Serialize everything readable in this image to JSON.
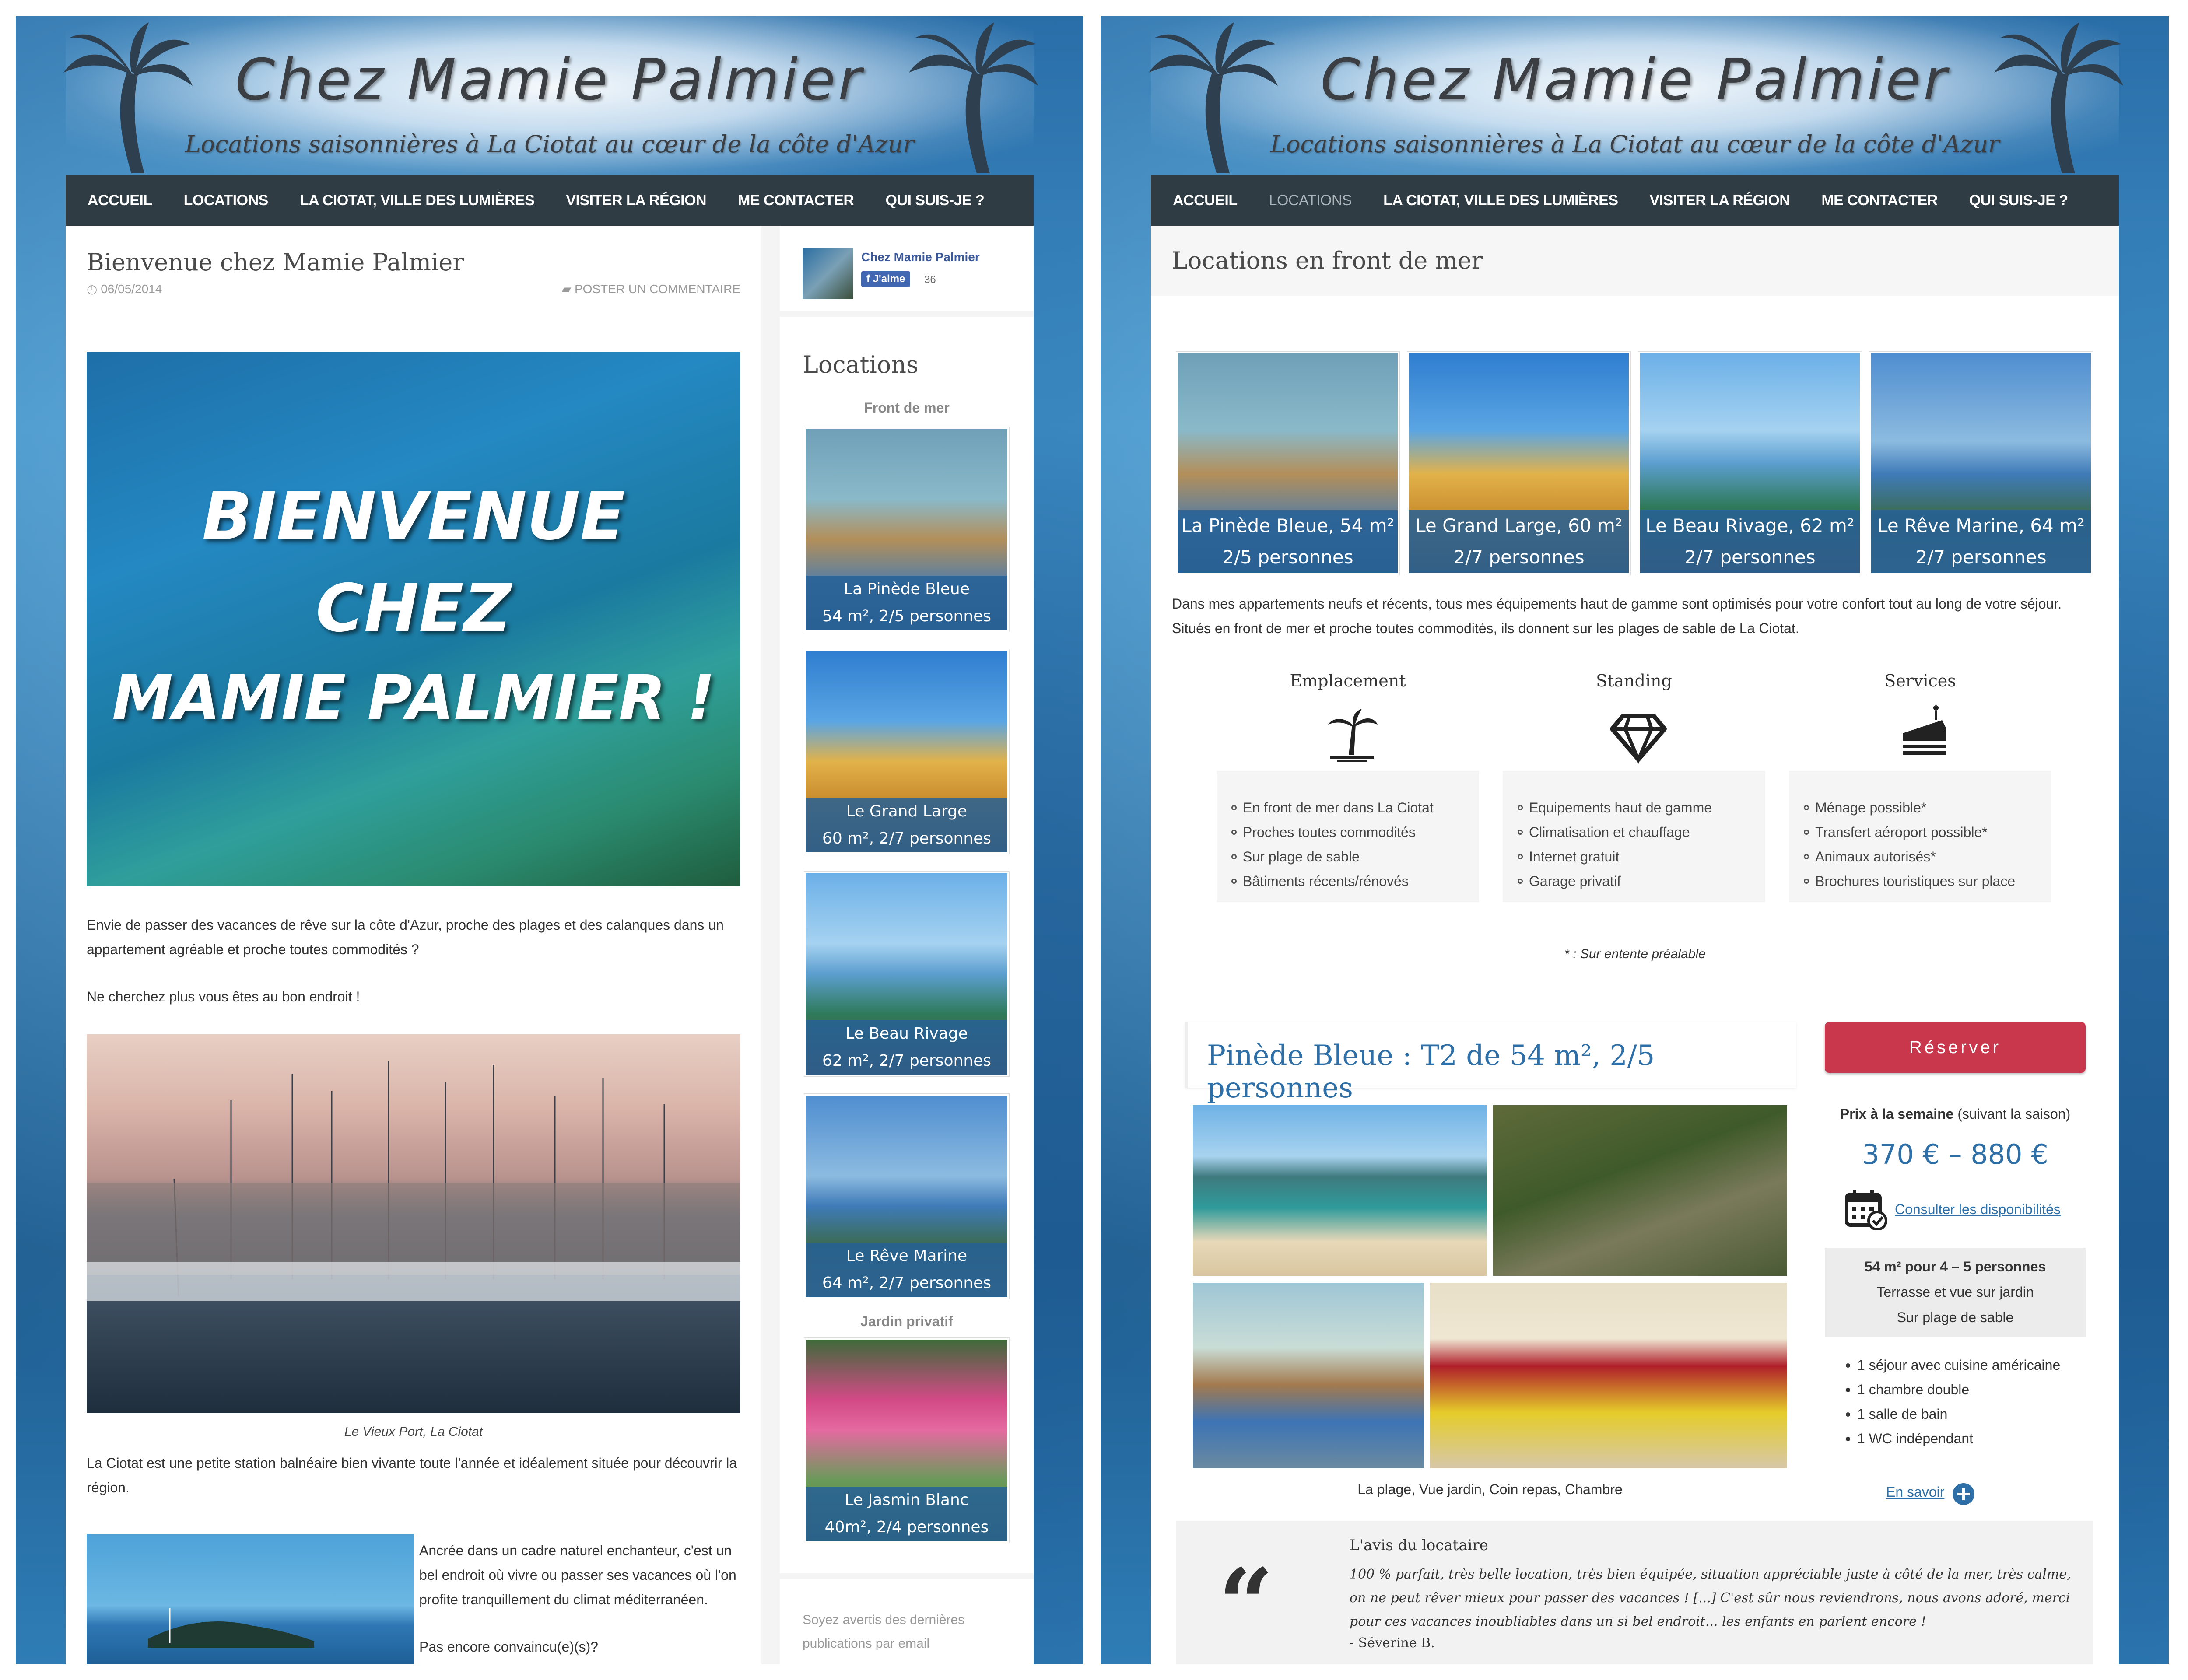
{
  "site": {
    "title": "Chez Mamie Palmier",
    "tagline": "Locations saisonnières à La Ciotat au cœur de la côte d'Azur",
    "nav": [
      "ACCUEIL",
      "LOCATIONS",
      "LA CIOTAT, VILLE DES LUMIÈRES",
      "VISITER LA RÉGION",
      "ME CONTACTER",
      "QUI SUIS-JE ?"
    ]
  },
  "left": {
    "post_title": "Bienvenue chez Mamie Palmier",
    "date": "06/05/2014",
    "comment_link": "POSTER UN COMMENTAIRE",
    "hero_text": [
      "BIENVENUE",
      "CHEZ",
      "MAMIE PALMIER !"
    ],
    "para1": "Envie de passer des vacances de rêve sur la côte d'Azur, proche des plages et des calanques dans un appartement agréable et proche toutes commodités ?",
    "para2": "Ne cherchez plus vous êtes au bon endroit !",
    "caption": "Le Vieux Port, La Ciotat",
    "para3": "La Ciotat est une petite station balnéaire bien vivante toute l'année et idéalement située pour découvrir la région.",
    "para4": "Ancrée dans un cadre naturel enchanteur, c'est un bel endroit où vivre ou passer ses vacances où l'on profite tranquillement du climat méditerranéen.",
    "para5": "Pas encore convaincu(e)(s)?",
    "sidebar": {
      "fb_name": "Chez Mamie Palmier",
      "fb_like": "J'aime",
      "fb_count": "36",
      "heading": "Locations",
      "group1": "Front de mer",
      "group2": "Jardin privatif",
      "cards": [
        {
          "name": "La Pinède Bleue",
          "detail": "54 m², 2/5 personnes"
        },
        {
          "name": "Le Grand Large",
          "detail": "60 m², 2/7 personnes"
        },
        {
          "name": "Le Beau Rivage",
          "detail": "62 m², 2/7 personnes"
        },
        {
          "name": "Le Rêve Marine",
          "detail": "64 m², 2/7 personnes"
        },
        {
          "name": "Le Jasmin Blanc",
          "detail": "40m², 2/4 personnes"
        }
      ],
      "newsletter": "Soyez avertis des dernières publications par email"
    }
  },
  "right": {
    "page_title": "Locations en front de mer",
    "tiles": [
      {
        "name": "La Pinède Bleue, 54 m²",
        "persons": "2/5 personnes"
      },
      {
        "name": "Le Grand Large, 60 m²",
        "persons": "2/7 personnes"
      },
      {
        "name": "Le Beau Rivage, 62 m²",
        "persons": "2/7 personnes"
      },
      {
        "name": "Le Rêve Marine, 64 m²",
        "persons": "2/7 personnes"
      }
    ],
    "intro": "Dans mes appartements neufs et récents, tous mes équipements haut de gamme sont optimisés pour votre confort tout au long de votre séjour. Situés en front de mer et proche toutes commodités, ils donnent sur les plages de sable de La Ciotat.",
    "columns": [
      {
        "title": "Emplacement",
        "icon": "palm-beach-icon",
        "items": [
          "En front de mer dans La Ciotat",
          "Proches toutes commodités",
          "Sur plage de sable",
          "Bâtiments récents/rénovés"
        ]
      },
      {
        "title": "Standing",
        "icon": "diamond-icon",
        "items": [
          "Equipements haut de gamme",
          "Climatisation et chauffage",
          "Internet gratuit",
          "Garage privatif"
        ]
      },
      {
        "title": "Services",
        "icon": "cake-icon",
        "items": [
          "Ménage possible*",
          "Transfert aéroport possible*",
          "Animaux autorisés*",
          "Brochures touristiques sur place"
        ]
      }
    ],
    "footnote": "* : Sur entente préalable",
    "listing_title": "Pinède Bleue : T2 de 54 m², 2/5 personnes",
    "reserve": "Réserver",
    "price_label": "Prix à la semaine",
    "price_note": "(suivant la saison)",
    "price": "370 € – 880 €",
    "availability": "Consulter les disponibilités",
    "info": [
      "54 m² pour 4 – 5 personnes",
      "Terrasse et vue sur jardin",
      "Sur plage de sable"
    ],
    "rooms": [
      "1 séjour avec cuisine américaine",
      "1 chambre double",
      "1 salle de bain",
      "1 WC indépendant"
    ],
    "photo_caption": "La plage, Vue jardin, Coin repas, Chambre",
    "more": "En savoir",
    "review_title": "L'avis du locataire",
    "review_text": "100 % parfait, très belle location, très bien équipée, situation appréciable juste à côté de la mer, très calme, on ne peut rêver mieux pour passer des vacances ! [...] C'est sûr nous reviendrons, nous avons adoré, merci pour ces vacances inoubliables dans un si bel endroit... les enfants en parlent encore !",
    "review_author": "- Séverine B."
  },
  "colors": {
    "nav": "#2f3c44",
    "accent": "#2d6fa6",
    "reserve": "#c8374c"
  }
}
